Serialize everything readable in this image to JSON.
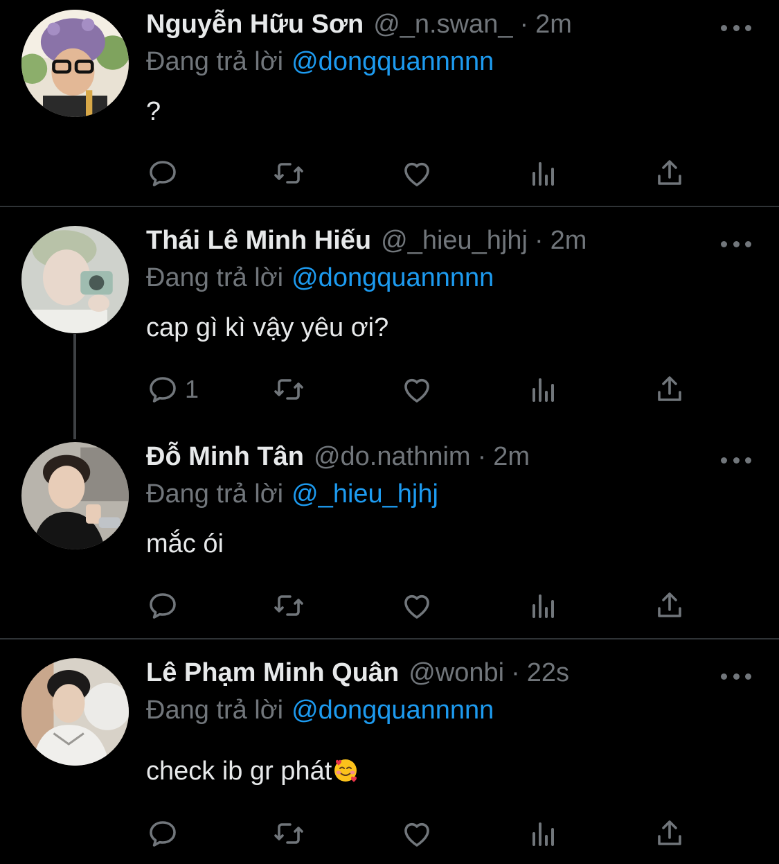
{
  "colors": {
    "background": "#000000",
    "text_primary": "#e7e9ea",
    "text_secondary": "#71767b",
    "link": "#1d9bf0",
    "divider": "#2f3336"
  },
  "icons": [
    "reply-icon",
    "retweet-icon",
    "like-icon",
    "views-icon",
    "share-icon",
    "more-icon"
  ],
  "tweets": [
    {
      "name": "Nguyễn Hữu Sơn",
      "handle": "@_n.swan_",
      "dot": "·",
      "time": "2m",
      "reply_prefix": "Đang trả lời",
      "reply_to": "@dongquannnnn",
      "text": "?",
      "reply_count": ""
    },
    {
      "name": "Thái Lê Minh Hiếu",
      "handle": "@_hieu_hjhj",
      "dot": "·",
      "time": "2m",
      "reply_prefix": "Đang trả lời",
      "reply_to": "@dongquannnnn",
      "text": "cap gì kì vậy yêu ơi?",
      "reply_count": "1"
    },
    {
      "name": "Đỗ Minh Tân",
      "handle": "@do.nathnim",
      "dot": "·",
      "time": "2m",
      "reply_prefix": "Đang trả lời",
      "reply_to": "@_hieu_hjhj",
      "text": "mắc ói",
      "reply_count": ""
    },
    {
      "name": "Lê Phạm Minh Quân",
      "handle": "@wonbi",
      "dot": "·",
      "time": "22s",
      "reply_prefix": "Đang trả lời",
      "reply_to": "@dongquannnnn",
      "text": "check ib gr phát",
      "emoji": "smiling-face-with-hearts",
      "reply_count": ""
    }
  ]
}
